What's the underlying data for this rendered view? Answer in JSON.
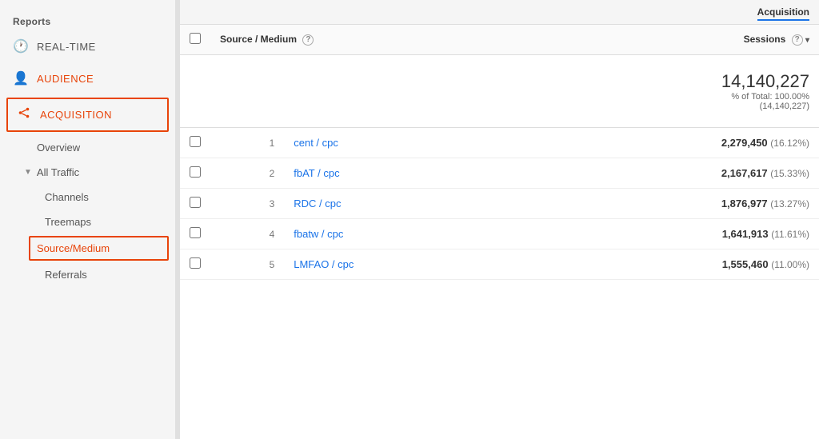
{
  "sidebar": {
    "section_title": "Reports",
    "items": [
      {
        "id": "realtime",
        "label": "REAL-TIME",
        "icon": "🕐"
      },
      {
        "id": "audience",
        "label": "AUDIENCE",
        "icon": "👤",
        "active": false,
        "is_audience": true
      },
      {
        "id": "acquisition",
        "label": "ACQUISITION",
        "icon": "⇒",
        "active": true
      }
    ],
    "sub_items": [
      {
        "id": "overview",
        "label": "Overview"
      },
      {
        "id": "all-traffic",
        "label": "All Traffic",
        "has_arrow": true
      },
      {
        "id": "channels",
        "label": "Channels"
      },
      {
        "id": "treemaps",
        "label": "Treemaps"
      },
      {
        "id": "source-medium",
        "label": "Source/Medium",
        "active": true
      },
      {
        "id": "referrals",
        "label": "Referrals"
      }
    ]
  },
  "table": {
    "acquisition_header": "Acquisition",
    "column_source_medium": "Source / Medium",
    "column_sessions": "Sessions",
    "help_icon_label": "?",
    "totals": {
      "value": "14,140,227",
      "percent_label": "% of Total: 100.00%",
      "total_in_parens": "(14,140,227)"
    },
    "rows": [
      {
        "rank": 1,
        "source": "cent / cpc",
        "sessions": "2,279,450",
        "pct": "(16.12%)"
      },
      {
        "rank": 2,
        "source": "fbAT / cpc",
        "sessions": "2,167,617",
        "pct": "(15.33%)"
      },
      {
        "rank": 3,
        "source": "RDC / cpc",
        "sessions": "1,876,977",
        "pct": "(13.27%)"
      },
      {
        "rank": 4,
        "source": "fbatw / cpc",
        "sessions": "1,641,913",
        "pct": "(11.61%)"
      },
      {
        "rank": 5,
        "source": "LMFAO / cpc",
        "sessions": "1,555,460",
        "pct": "(11.00%)"
      }
    ]
  }
}
